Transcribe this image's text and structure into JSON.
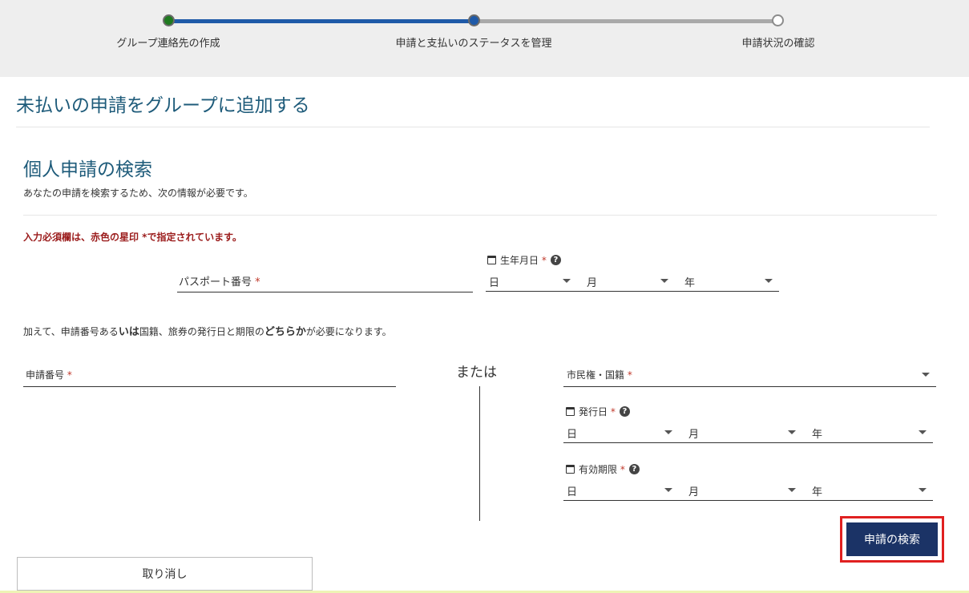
{
  "stepper": {
    "steps": [
      "グループ連絡先の作成",
      "申請と支払いのステータスを管理",
      "申請状況の確認"
    ]
  },
  "page": {
    "title": "未払いの申請をグループに追加する"
  },
  "section": {
    "title": "個人申請の検索",
    "subtitle": "あなたの申請を検索するため、次の情報が必要です。",
    "required_note": "入力必須欄は、赤色の星印 *で指定されています。"
  },
  "passport": {
    "label": "パスポート番号",
    "required": "*"
  },
  "dob": {
    "label": "生年月日",
    "required": "*",
    "day": "日",
    "month": "月",
    "year": "年"
  },
  "or_note": {
    "part1": "加えて、申請番号ある",
    "bold1": "いは",
    "part2": "国籍、旅券の発行日と期限の",
    "bold2": "どちらか",
    "part3": "が必要になります。"
  },
  "application_number": {
    "label": "申請番号",
    "required": "*"
  },
  "or_word": "または",
  "citizenship": {
    "label": "市民権・国籍",
    "required": "*"
  },
  "issue_date": {
    "label": "発行日",
    "required": "*",
    "day": "日",
    "month": "月",
    "year": "年"
  },
  "expiry_date": {
    "label": "有効期限",
    "required": "*",
    "day": "日",
    "month": "月",
    "year": "年"
  },
  "buttons": {
    "search": "申請の検索",
    "cancel": "取り消し"
  },
  "icons": {
    "help_glyph": "?"
  }
}
